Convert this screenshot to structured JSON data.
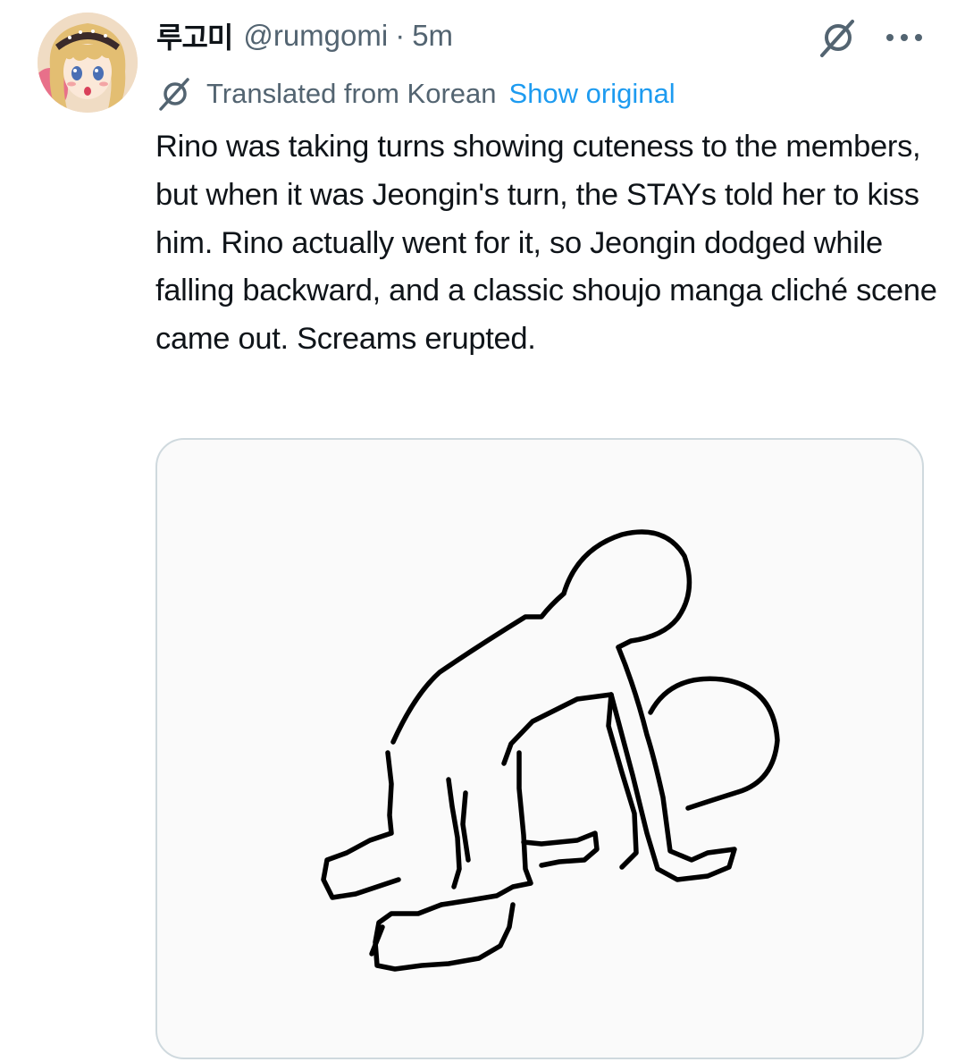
{
  "tweet": {
    "display_name": "루고미",
    "handle": "@rumgomi",
    "separator": "·",
    "time": "5m",
    "translation": {
      "label": "Translated from Korean",
      "show_original": "Show original"
    },
    "text": "Rino was taking turns showing cuteness to the members, but when it was Jeongin's turn, the STAYs told her to kiss him. Rino actually went for it, so Jeongin dodged while falling backward, and a classic shoujo manga cliché scene came out. Screams erupted."
  },
  "icons": {
    "avatar": "anime-girl-avatar",
    "grok": "grok-icon",
    "more": "more-horizontal-icon",
    "translate": "translate-icon"
  },
  "colors": {
    "text_primary": "#0f1419",
    "text_secondary": "#536471",
    "link": "#1d9bf0",
    "media_border": "#cfd9de",
    "media_background": "#fafafa"
  }
}
